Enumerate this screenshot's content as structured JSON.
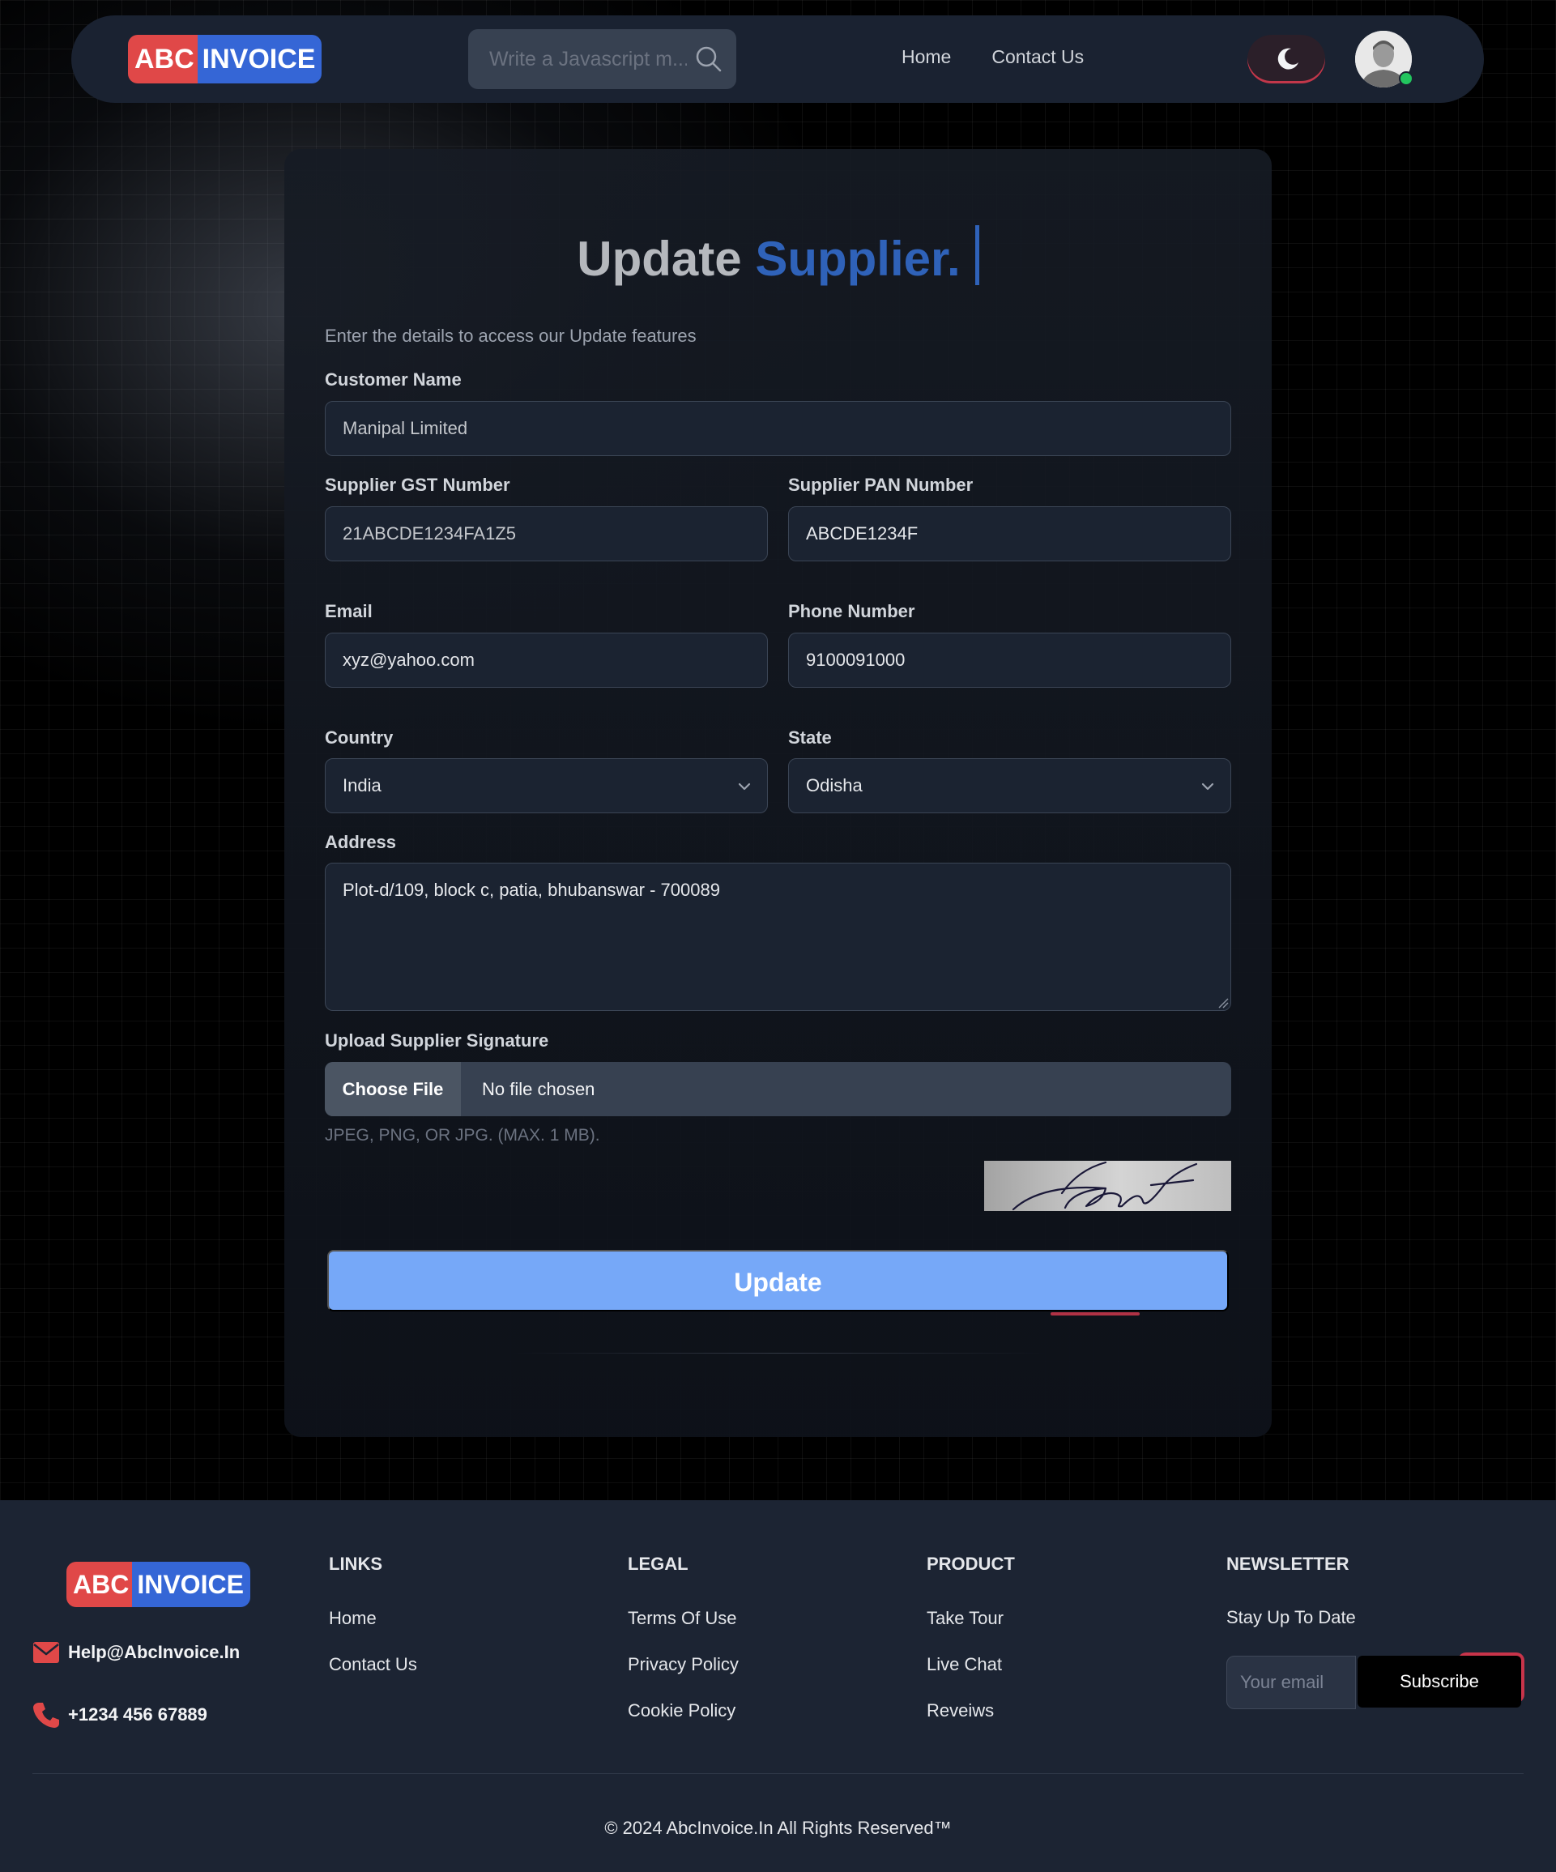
{
  "brand": {
    "part1": "ABC",
    "part2": "INVOICE",
    "color1": "#e04848",
    "color2": "#3566d6"
  },
  "navbar": {
    "search_placeholder": "Write a Javascript m...",
    "links": [
      "Home",
      "Contact Us"
    ],
    "theme_icon": "moon-icon",
    "avatar_icon": "user-avatar",
    "online": true
  },
  "form": {
    "title_part1": "Update",
    "title_part2": "Supplier.",
    "subtitle": "Enter the details to access our Update features",
    "customer_name": {
      "label": "Customer Name",
      "value": "Manipal Limited"
    },
    "gst": {
      "label": "Supplier GST Number",
      "value": "21ABCDE1234FA1Z5"
    },
    "pan": {
      "label": "Supplier PAN Number",
      "value": "ABCDE1234F"
    },
    "email": {
      "label": "Email",
      "value": "xyz@yahoo.com"
    },
    "phone": {
      "label": "Phone Number",
      "value": "9100091000"
    },
    "country": {
      "label": "Country",
      "value": "India"
    },
    "state": {
      "label": "State",
      "value": "Odisha"
    },
    "address": {
      "label": "Address",
      "value": "Plot-d/109, block c, patia, bhubanswar - 700089"
    },
    "signature": {
      "label": "Upload Supplier Signature",
      "button": "Choose File",
      "status": "No file chosen",
      "hint": "JPEG, PNG, OR JPG. (MAX. 1 MB)."
    },
    "submit": "Update",
    "accent_color": "#2f62b9",
    "button_color": "#76a8f8"
  },
  "footer": {
    "email": "Help@AbcInvoice.In",
    "phone": "+1234 456 67889",
    "links": {
      "heading": "LINKS",
      "items": [
        "Home",
        "Contact Us"
      ]
    },
    "legal": {
      "heading": "LEGAL",
      "items": [
        "Terms Of Use",
        "Privacy Policy",
        "Cookie Policy"
      ]
    },
    "product": {
      "heading": "PRODUCT",
      "items": [
        "Take Tour",
        "Live Chat",
        "Reveiws"
      ]
    },
    "newsletter": {
      "heading": "NEWSLETTER",
      "text": "Stay Up To Date",
      "placeholder": "Your email",
      "button": "Subscribe"
    },
    "copyright": "© 2024 AbcInvoice.In All Rights Reserved™"
  }
}
